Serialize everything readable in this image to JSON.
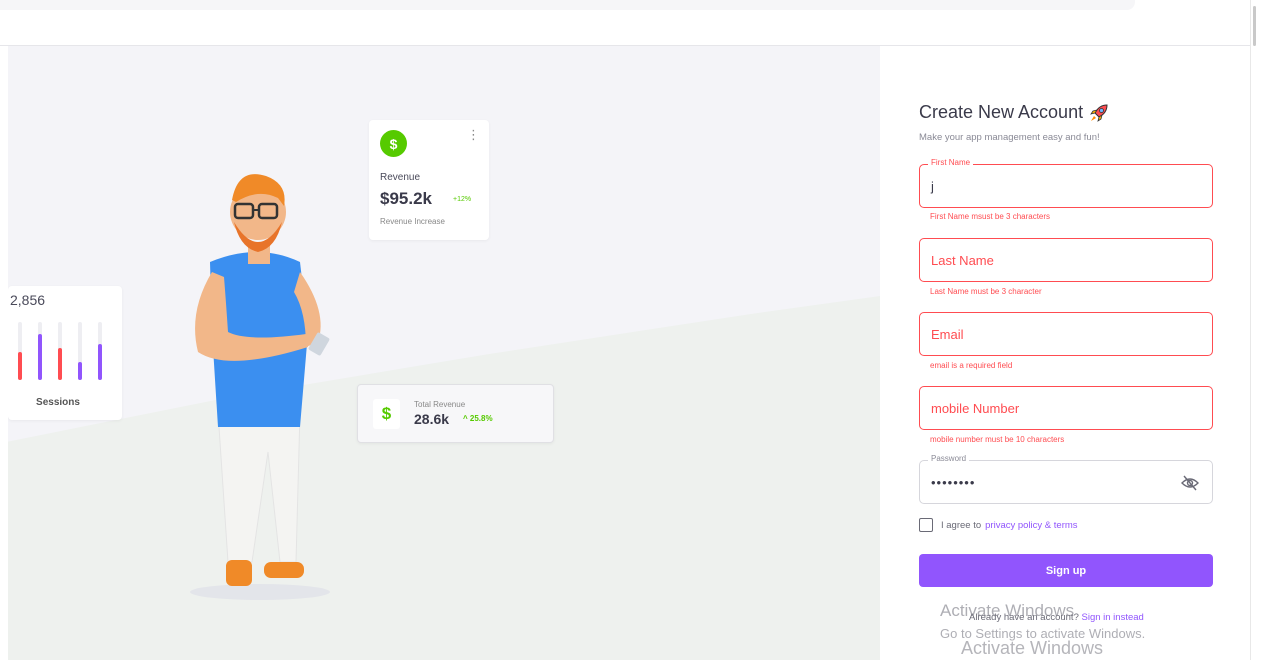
{
  "sessions_card": {
    "value": "2,856",
    "label": "Sessions"
  },
  "revenue_card": {
    "icon": "dollar-icon",
    "title": "Revenue",
    "amount": "$95.2k",
    "change": "+12%",
    "subtitle": "Revenue Increase"
  },
  "total_revenue_card": {
    "icon": "dollar-icon",
    "label": "Total Revenue",
    "value": "28.6k",
    "change": "25.8%"
  },
  "form": {
    "title": "Create New Account",
    "title_icon": "rocket-emoji",
    "subtitle": "Make your app management easy and fun!",
    "first_name": {
      "label": "First Name",
      "value": "j",
      "error": "First Name msust be 3 characters"
    },
    "last_name": {
      "placeholder": "Last Name",
      "error": "Last Name must be 3 character"
    },
    "email": {
      "placeholder": "Email",
      "error": "email is a required field"
    },
    "mobile": {
      "placeholder": "mobile Number",
      "error": "mobile number must be 10 characters"
    },
    "password": {
      "label": "Password",
      "value": "••••••••",
      "toggle_icon": "eye-off-icon"
    },
    "agree": {
      "text": "I agree to",
      "link": "privacy policy & terms",
      "checked": false
    },
    "signup_button": "Sign up",
    "already": {
      "text": "Already have an account?",
      "link": "Sign in instead"
    }
  },
  "watermark": {
    "line1": "Activate Windows",
    "line2": "Go to Settings to activate Windows.",
    "line3": "Activate Windows"
  },
  "colors": {
    "primary": "#9155fd",
    "error": "#ff4c51",
    "success": "#56ca00"
  }
}
